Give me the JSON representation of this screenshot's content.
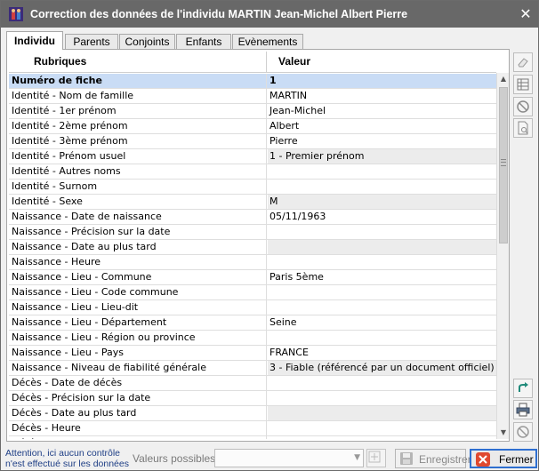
{
  "window": {
    "title": "Correction des données de l'individu  MARTIN Jean-Michel Albert Pierre",
    "app_icon": "family-icon",
    "close_glyph": "✕"
  },
  "tabs": [
    {
      "label": "Individu",
      "active": true
    },
    {
      "label": "Parents",
      "active": false
    },
    {
      "label": "Conjoints",
      "active": false
    },
    {
      "label": "Enfants",
      "active": false
    },
    {
      "label": "Evènements",
      "active": false
    }
  ],
  "grid": {
    "headers": {
      "rubriques": "Rubriques",
      "valeur": "Valeur"
    },
    "rows": [
      {
        "rubrique": "Numéro de fiche",
        "valeur": "1",
        "highlight": true
      },
      {
        "rubrique": "Identité - Nom de famille",
        "valeur": "MARTIN"
      },
      {
        "rubrique": "Identité - 1er prénom",
        "valeur": "Jean-Michel"
      },
      {
        "rubrique": "Identité - 2ème prénom",
        "valeur": "Albert"
      },
      {
        "rubrique": "Identité - 3ème prénom",
        "valeur": "Pierre"
      },
      {
        "rubrique": "Identité - Prénom usuel",
        "valeur": "1 - Premier prénom",
        "grey": true
      },
      {
        "rubrique": "Identité - Autres noms",
        "valeur": ""
      },
      {
        "rubrique": "Identité - Surnom",
        "valeur": ""
      },
      {
        "rubrique": "Identité - Sexe",
        "valeur": "M",
        "grey": true
      },
      {
        "rubrique": "Naissance - Date de naissance",
        "valeur": "05/11/1963"
      },
      {
        "rubrique": "Naissance - Précision sur la date",
        "valeur": ""
      },
      {
        "rubrique": "Naissance - Date au plus tard",
        "valeur": "",
        "grey": true
      },
      {
        "rubrique": "Naissance - Heure",
        "valeur": ""
      },
      {
        "rubrique": "Naissance - Lieu - Commune",
        "valeur": "Paris 5ème"
      },
      {
        "rubrique": "Naissance - Lieu - Code commune",
        "valeur": ""
      },
      {
        "rubrique": "Naissance - Lieu - Lieu-dit",
        "valeur": ""
      },
      {
        "rubrique": "Naissance - Lieu - Département",
        "valeur": "Seine"
      },
      {
        "rubrique": "Naissance - Lieu - Région ou province",
        "valeur": ""
      },
      {
        "rubrique": "Naissance - Lieu - Pays",
        "valeur": "FRANCE"
      },
      {
        "rubrique": "Naissance - Niveau de fiabilité générale",
        "valeur": "3 - Fiable (référencé par un document officiel)",
        "grey": true
      },
      {
        "rubrique": "Décès - Date de décès",
        "valeur": ""
      },
      {
        "rubrique": "Décès - Précision sur la date",
        "valeur": ""
      },
      {
        "rubrique": "Décès - Date au plus tard",
        "valeur": "",
        "grey": true
      },
      {
        "rubrique": "Décès - Heure",
        "valeur": ""
      },
      {
        "rubrique": "Décès - Lieu - Commune",
        "valeur": ""
      }
    ]
  },
  "scrollbar": {
    "up_glyph": "▲",
    "down_glyph": "▼"
  },
  "side_buttons": [
    "eraser-icon",
    "table-icon",
    "cancel-icon",
    "document-search-icon",
    "refresh-icon",
    "print-icon",
    "forbidden-icon"
  ],
  "footer": {
    "warning_line1": "Attention, ici aucun contrôle",
    "warning_line2": "n'est effectué sur les données",
    "valeurs_label": "Valeurs possibles",
    "valeurs_value": "",
    "save_label": "Enregistrer",
    "close_label": "Fermer"
  },
  "colors": {
    "titlebar": "#686868",
    "selected_row": "#c9dcf5",
    "warning_text": "#1f3f86",
    "close_border": "#2e6fd0",
    "close_icon": "#e0492f"
  }
}
